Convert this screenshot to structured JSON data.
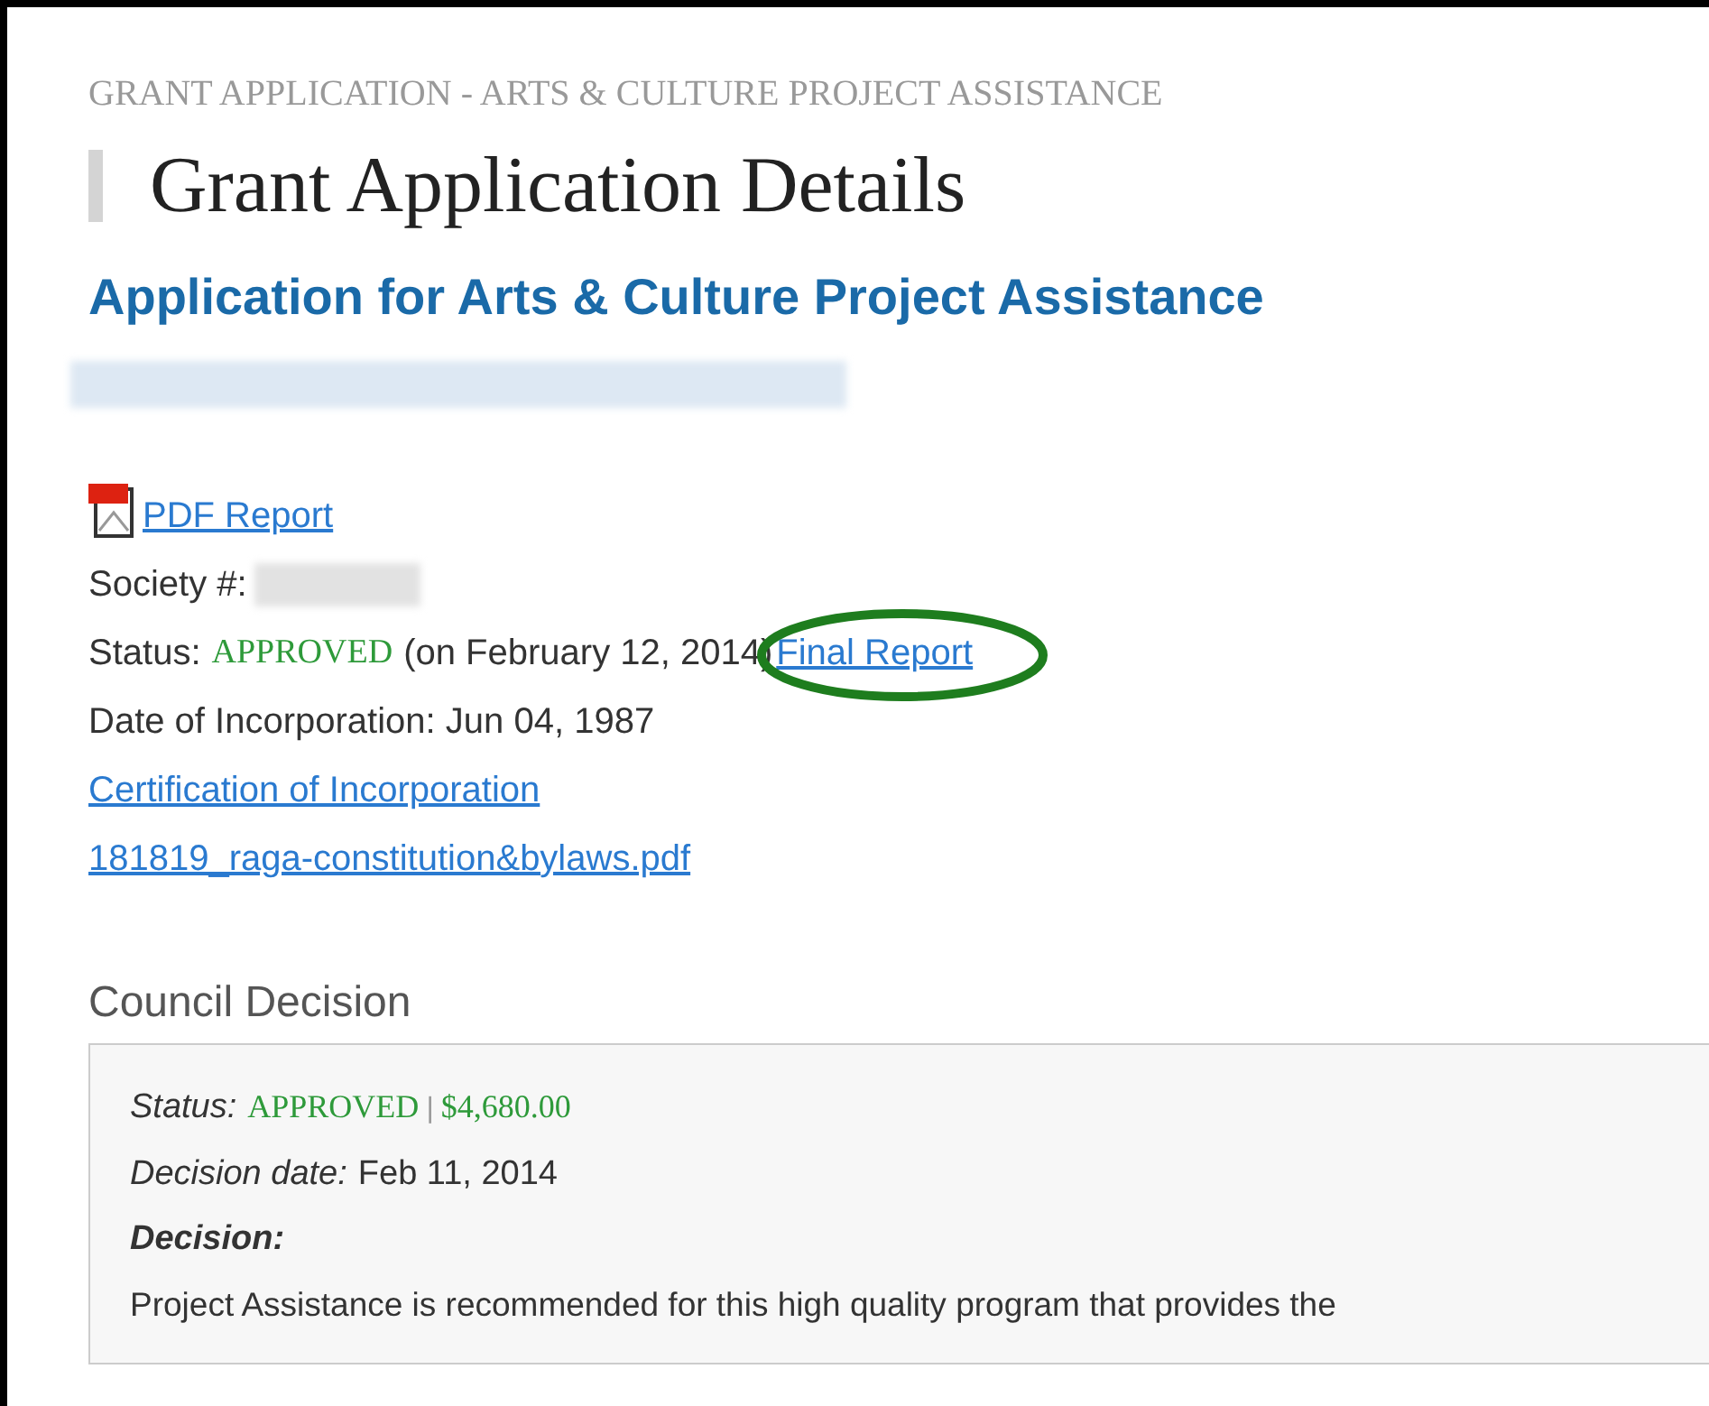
{
  "breadcrumb": "GRANT APPLICATION - ARTS & CULTURE PROJECT ASSISTANCE",
  "title": "Grant Application Details",
  "application_heading": "Application for Arts & Culture Project Assistance",
  "pdf_report_link": "PDF Report",
  "society": {
    "label": "Society #:"
  },
  "status": {
    "label": "Status:",
    "value": "APPROVED",
    "date": "(on February 12, 2014)"
  },
  "final_report_link": {
    "label": "Final Report",
    "circled": true
  },
  "incorporation": {
    "label": "Date of Incorporation:",
    "value": "Jun 04, 1987"
  },
  "links": [
    "Certification of Incorporation",
    "181819_raga-constitution&bylaws.pdf"
  ],
  "council_decision": {
    "heading": "Council Decision",
    "status_label": "Status:",
    "status_value": "APPROVED",
    "separator": "|",
    "amount": "$4,680.00",
    "date_label": "Decision date:",
    "date_value": "Feb 11, 2014",
    "decision_label": "Decision:",
    "decision_text": "Project Assistance is recommended for this high quality program that provides the"
  }
}
